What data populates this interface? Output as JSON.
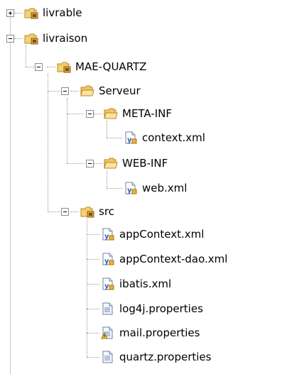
{
  "tree": {
    "nodes": [
      {
        "label": "livrable",
        "icon": "package-folder-icon",
        "state": "collapsed"
      },
      {
        "label": "livraison",
        "icon": "package-folder-icon",
        "state": "expanded"
      },
      {
        "label": "MAE-QUARTZ",
        "icon": "package-folder-icon",
        "state": "expanded"
      },
      {
        "label": "Serveur",
        "icon": "folder-open-icon",
        "state": "expanded"
      },
      {
        "label": "META-INF",
        "icon": "folder-open-icon",
        "state": "expanded"
      },
      {
        "label": "context.xml",
        "icon": "xml-file-icon",
        "state": "leaf"
      },
      {
        "label": "WEB-INF",
        "icon": "folder-open-icon",
        "state": "expanded"
      },
      {
        "label": "web.xml",
        "icon": "xml-file-icon",
        "state": "leaf"
      },
      {
        "label": "src",
        "icon": "package-folder-icon",
        "state": "expanded"
      },
      {
        "label": "appContext.xml",
        "icon": "xml-file-icon",
        "state": "leaf"
      },
      {
        "label": "appContext-dao.xml",
        "icon": "xml-file-icon",
        "state": "leaf"
      },
      {
        "label": "ibatis.xml",
        "icon": "xml-file-icon",
        "state": "leaf"
      },
      {
        "label": "log4j.properties",
        "icon": "properties-file-icon",
        "state": "leaf"
      },
      {
        "label": "mail.properties",
        "icon": "properties-file-warning-icon",
        "state": "leaf"
      },
      {
        "label": "quartz.properties",
        "icon": "properties-file-icon",
        "state": "leaf"
      }
    ]
  }
}
